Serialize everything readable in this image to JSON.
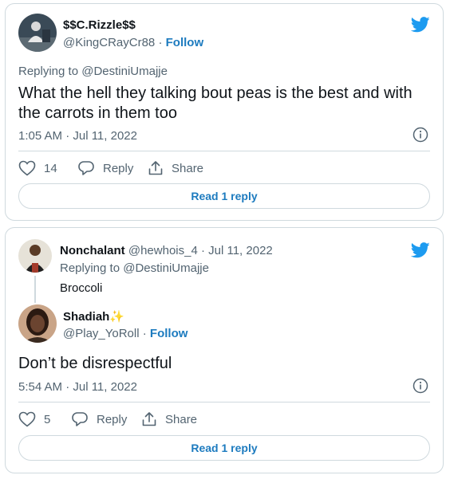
{
  "tweet1": {
    "display_name": "$$C.Rizzle$$",
    "handle": "@KingCRayCr88",
    "separator": "·",
    "follow_label": "Follow",
    "replying_to_prefix": "Replying to",
    "replying_to_handle": "@DestiniUmajje",
    "text": "What the hell they talking bout peas is the best and with the carrots in them too",
    "time": "1:05 AM · Jul 11, 2022",
    "likes": "14",
    "reply_label": "Reply",
    "share_label": "Share",
    "read_replies_label": "Read 1 reply"
  },
  "tweet2": {
    "parent": {
      "display_name": "Nonchalant",
      "handle_and_date": "@hewhois_4 · Jul 11, 2022",
      "replying_to_prefix": "Replying to",
      "replying_to_handle": "@DestiniUmajje",
      "text": "Broccoli"
    },
    "display_name": "Shadiah",
    "name_emoji": "✨",
    "handle": "@Play_YoRoll",
    "separator": "·",
    "follow_label": "Follow",
    "text": "Don’t be disrespectful",
    "time": "5:54 AM · Jul 11, 2022",
    "likes": "5",
    "reply_label": "Reply",
    "share_label": "Share",
    "read_replies_label": "Read 1 reply"
  },
  "colors": {
    "twitter_blue": "#1d9bf0",
    "link_blue": "#1d7bbf",
    "secondary_text": "#536471",
    "border": "#cfd9de"
  },
  "icons": [
    "twitter-bird-icon",
    "info-icon",
    "heart-icon",
    "reply-bubble-icon",
    "share-icon"
  ]
}
